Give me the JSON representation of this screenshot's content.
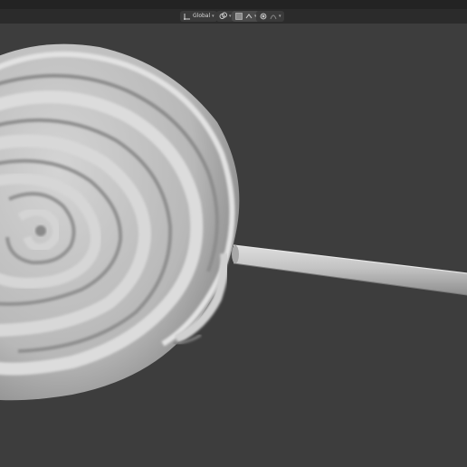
{
  "header": {
    "transform_orientation": {
      "label": "Global",
      "icon": "transform-orientation-icon"
    },
    "pivot_icon": "pivot-point-icon",
    "snapping_icon": "snap-magnet-icon",
    "proportional_icon": "proportional-editing-icon",
    "overlay_icon": "overlay-icon"
  },
  "viewport": {
    "object": "lollipop-sculpt",
    "background": "#3d3d3d",
    "material_color": "#c8c8c8"
  }
}
